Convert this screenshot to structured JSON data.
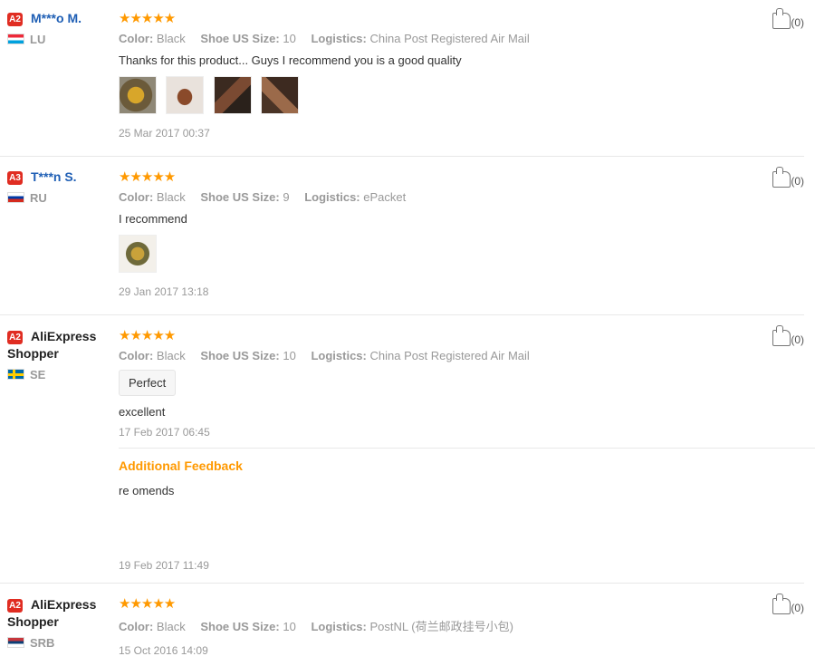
{
  "like_count": "(0)",
  "labels": {
    "color": "Color:",
    "size": "Shoe US Size:",
    "logistics": "Logistics:"
  },
  "reviews": [
    {
      "badge": "A2",
      "name": "M***o M.",
      "country": "LU",
      "stars": "★★★★★",
      "color": "Black",
      "size": "10",
      "logistics": "China Post Registered Air Mail",
      "text": "Thanks for this product... Guys I recommend you is a good quality",
      "date": "25 Mar 2017 00:37"
    },
    {
      "badge": "A3",
      "name": "T***n S.",
      "country": "RU",
      "stars": "★★★★★",
      "color": "Black",
      "size": "9",
      "logistics": "ePacket",
      "text": "I recommend",
      "date": "29 Jan 2017 13:18"
    },
    {
      "badge": "A2",
      "name": "AliExpress Shopper",
      "country": "SE",
      "stars": "★★★★★",
      "color": "Black",
      "size": "10",
      "logistics": "China Post Registered Air Mail",
      "tag": "Perfect",
      "text": "excellent",
      "date": "17 Feb 2017 06:45",
      "additional_title": "Additional Feedback",
      "additional_text": "re omends",
      "additional_date": "19 Feb 2017 11:49"
    },
    {
      "badge": "A2",
      "name": "AliExpress Shopper",
      "country": "SRB",
      "stars": "★★★★★",
      "color": "Black",
      "size": "10",
      "logistics": "PostNL (荷兰邮政挂号小包)",
      "date": "15 Oct 2016 14:09"
    }
  ]
}
